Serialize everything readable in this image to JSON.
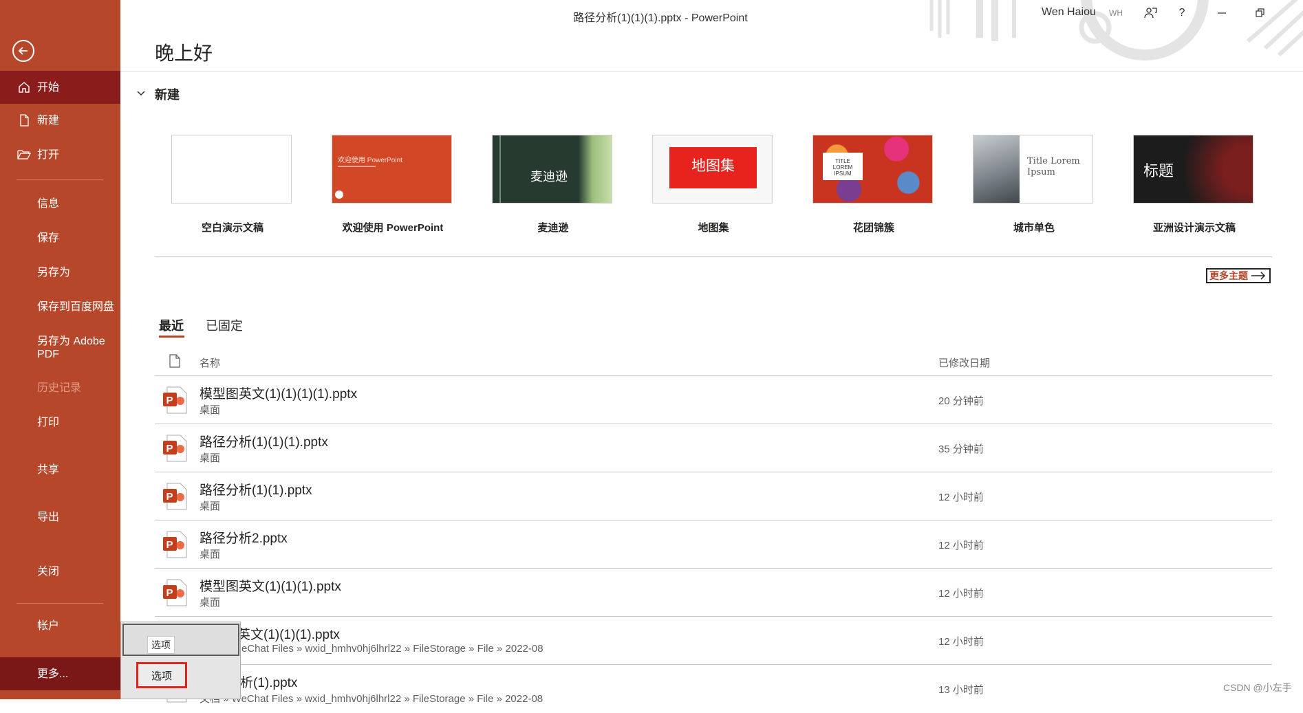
{
  "window": {
    "title": "路径分析(1)(1)(1).pptx  -  PowerPoint",
    "user_name": "Wen Haiou",
    "user_initials": "WH"
  },
  "sidebar": {
    "items": [
      {
        "label": "开始",
        "icon": "home-icon"
      },
      {
        "label": "新建",
        "icon": "new-document-icon"
      },
      {
        "label": "打开",
        "icon": "open-folder-icon"
      },
      {
        "label": "信息"
      },
      {
        "label": "保存"
      },
      {
        "label": "另存为"
      },
      {
        "label": "保存到百度网盘"
      },
      {
        "label": "另存为 Adobe\nPDF"
      },
      {
        "label": "历史记录"
      },
      {
        "label": "打印"
      },
      {
        "label": "共享"
      },
      {
        "label": "导出"
      },
      {
        "label": "关闭"
      },
      {
        "label": "帐户"
      },
      {
        "label": "更多..."
      }
    ]
  },
  "main": {
    "greeting": "晚上好",
    "new_section_title": "新建",
    "templates": [
      {
        "label": "空白演示文稿",
        "thumb_text": ""
      },
      {
        "label": "欢迎使用 PowerPoint",
        "thumb_text": "欢迎使用 PowerPoint"
      },
      {
        "label": "麦迪逊",
        "thumb_text": "麦迪逊"
      },
      {
        "label": "地图集",
        "thumb_text": "地图集"
      },
      {
        "label": "花团锦簇",
        "thumb_text": "TITLE LOREM IPSUM"
      },
      {
        "label": "城市单色",
        "thumb_text": "Title Lorem Ipsum"
      },
      {
        "label": "亚洲设计演示文稿",
        "thumb_text": "标题"
      }
    ],
    "more_themes": "更多主题",
    "tabs": [
      {
        "label": "最近"
      },
      {
        "label": "已固定"
      }
    ],
    "columns": {
      "name": "名称",
      "date": "已修改日期"
    },
    "files": [
      {
        "name": "模型图英文(1)(1)(1)(1).pptx",
        "location": "桌面",
        "date": "20 分钟前"
      },
      {
        "name": "路径分析(1)(1)(1).pptx",
        "location": "桌面",
        "date": "35 分钟前"
      },
      {
        "name": "路径分析(1)(1).pptx",
        "location": "桌面",
        "date": "12 小时前"
      },
      {
        "name": "路径分析2.pptx",
        "location": "桌面",
        "date": "12 小时前"
      },
      {
        "name": "模型图英文(1)(1)(1).pptx",
        "location": "桌面",
        "date": "12 小时前"
      },
      {
        "name": "英文(1)(1)(1).pptx",
        "location": "eChat Files » wxid_hmhv0hj6lhrl22 » FileStorage » File » 2022-08",
        "date": "12 小时前"
      },
      {
        "name": "析(1).pptx",
        "location": "文档 » WeChat Files » wxid_hmhv0hj6lhrl22 » FileStorage » File » 2022-08",
        "date": "13 小时前"
      }
    ]
  },
  "popup": {
    "tooltip": "选项",
    "option_label": "选项"
  },
  "watermark": "CSDN @小左手",
  "colors": {
    "accent": "#b7472a",
    "active_nav": "#8a1c1c",
    "highlight_border": "#e0241b"
  }
}
